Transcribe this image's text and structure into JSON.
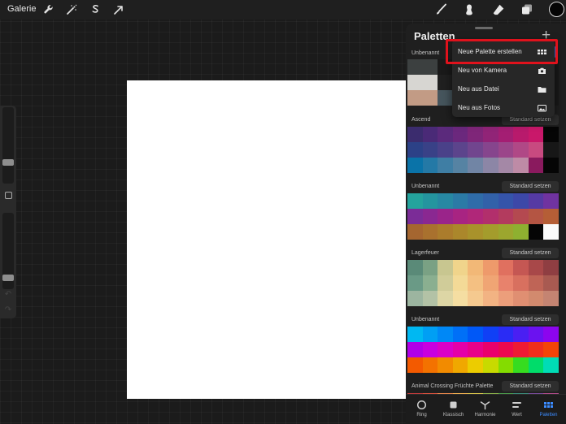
{
  "topbar": {
    "gallery_label": "Galerie",
    "left_icons": [
      "wrench-icon",
      "magic-wand-icon",
      "selection-s-icon",
      "arrow-cursor-icon"
    ],
    "right_icons": [
      "brush-icon",
      "smudge-icon",
      "eraser-icon",
      "layers-icon"
    ],
    "current_color": "#050505"
  },
  "panel": {
    "title": "Paletten",
    "add_icon": "plus-icon",
    "palettes": [
      {
        "name": "Unbenannt",
        "standard_label": "",
        "rows": [
          [
            "#3c4040",
            "#3c4040",
            "#1a1a1a",
            "#1a1a1a",
            "#1a1a1a",
            "#1a1a1a",
            "#1a1a1a",
            "#1a1a1a",
            "#1a1a1a",
            "#1a1a1a"
          ],
          [
            "#d7d6d2",
            "#d7d6d2",
            "#202020",
            "#1a1a1a",
            "#1a1a1a",
            "#1a1a1a",
            "#1a1a1a",
            "#1a1a1a",
            "#1a1a1a",
            "#1a1a1a"
          ],
          [
            "#c29b85",
            "#c29b85",
            "#46555d",
            "#1a1a1a",
            "#1a1a1a",
            "#1a1a1a",
            "#1a1a1a",
            "#1a1a1a",
            "#1a1a1a",
            "#1a1a1a"
          ]
        ]
      },
      {
        "name": "Ascend",
        "standard_label": "Standard setzen",
        "rows": [
          [
            "#3b2c6e",
            "#4a2a77",
            "#5b2a7c",
            "#6b287d",
            "#7f2679",
            "#912477",
            "#a41e73",
            "#b81a6c",
            "#c9186a",
            "#050505"
          ],
          [
            "#2c4187",
            "#394187",
            "#4a4189",
            "#5c448c",
            "#71458e",
            "#86458d",
            "#9b468a",
            "#b04886",
            "#c84a80",
            "#171717"
          ],
          [
            "#0a73a8",
            "#2479a6",
            "#3f7ea4",
            "#5683a3",
            "#7185a5",
            "#8c86a6",
            "#a488a6",
            "#be8ba6",
            "#8a1a5e",
            "#050505"
          ]
        ]
      },
      {
        "name": "Unbenannt",
        "standard_label": "Standard setzen",
        "rows": [
          [
            "#24a39d",
            "#24959f",
            "#2788a3",
            "#2b7aa6",
            "#2f6ca9",
            "#3261a9",
            "#3554aa",
            "#3c48a8",
            "#553aa3",
            "#7033a0"
          ],
          [
            "#7b2c97",
            "#8a2891",
            "#9a248a",
            "#a82482",
            "#b02779",
            "#b22f6c",
            "#b33b5e",
            "#b44950",
            "#b45543",
            "#b55e36"
          ],
          [
            "#a56630",
            "#a9712e",
            "#ab7c2c",
            "#ab872b",
            "#a9922b",
            "#a49c2c",
            "#9ca62e",
            "#8eb030",
            "#050505",
            "#fafafa"
          ]
        ]
      },
      {
        "name": "Lagerfeuer",
        "standard_label": "Standard setzen",
        "rows": [
          [
            "#5a8a78",
            "#7aa184",
            "#c8c690",
            "#f0d48b",
            "#f2b877",
            "#ee9a6b",
            "#e0705f",
            "#c55753",
            "#a84849",
            "#8f3e42"
          ],
          [
            "#6a9a86",
            "#8aaf90",
            "#d0cc99",
            "#f3da97",
            "#f4c082",
            "#f0a574",
            "#e8826c",
            "#d8705f",
            "#bf6456",
            "#a85a51"
          ],
          [
            "#9cb5a0",
            "#b3c2a6",
            "#ddd6a5",
            "#f5dea2",
            "#f5c98f",
            "#f2b383",
            "#ec9e7b",
            "#e08f72",
            "#d28a6e",
            "#c48472"
          ]
        ]
      },
      {
        "name": "Unbenannt",
        "standard_label": "Standard setzen",
        "rows": [
          [
            "#00b8f2",
            "#009ff4",
            "#0088f6",
            "#0070f7",
            "#0058f7",
            "#1040f6",
            "#2a2cf5",
            "#4a1ff3",
            "#6b12f0",
            "#8c05ee"
          ],
          [
            "#b000e8",
            "#c800e0",
            "#da00c8",
            "#e400a8",
            "#e8008a",
            "#ea006c",
            "#ec0850",
            "#ee1a34",
            "#f02e1c",
            "#f34408"
          ],
          [
            "#f35a00",
            "#f37200",
            "#f28b00",
            "#f0a800",
            "#eccc00",
            "#c8da00",
            "#84dc00",
            "#36dc20",
            "#00dc6a",
            "#00dcb6"
          ]
        ]
      },
      {
        "name": "Animal Crossing Früchte Palette",
        "standard_label": "Standard setzen",
        "rows": [
          [
            "#c23b3b",
            "#d9533e",
            "#e8874b",
            "#f0b050",
            "#d9c54b",
            "#8bb04a",
            "#4b9a4b",
            "#3b8a7a",
            "#7a4b9a",
            "#b04b8a"
          ]
        ]
      }
    ]
  },
  "menu": {
    "items": [
      {
        "label": "Neue Palette erstellen",
        "icon": "grid-icon"
      },
      {
        "label": "Neu von Kamera",
        "icon": "camera-icon"
      },
      {
        "label": "Neu aus Datei",
        "icon": "folder-icon"
      },
      {
        "label": "Neu aus Fotos",
        "icon": "photo-icon"
      }
    ]
  },
  "tabs": [
    {
      "label": "Ring",
      "icon": "ring-icon",
      "active": false
    },
    {
      "label": "Klassisch",
      "icon": "square-icon",
      "active": false
    },
    {
      "label": "Harmonie",
      "icon": "harmony-icon",
      "active": false
    },
    {
      "label": "Wert",
      "icon": "sliders-icon",
      "active": false
    },
    {
      "label": "Paletten",
      "icon": "palette-grid-icon",
      "active": true
    }
  ],
  "sidebar": {
    "brush_size": 0.35,
    "opacity": 0.88
  }
}
